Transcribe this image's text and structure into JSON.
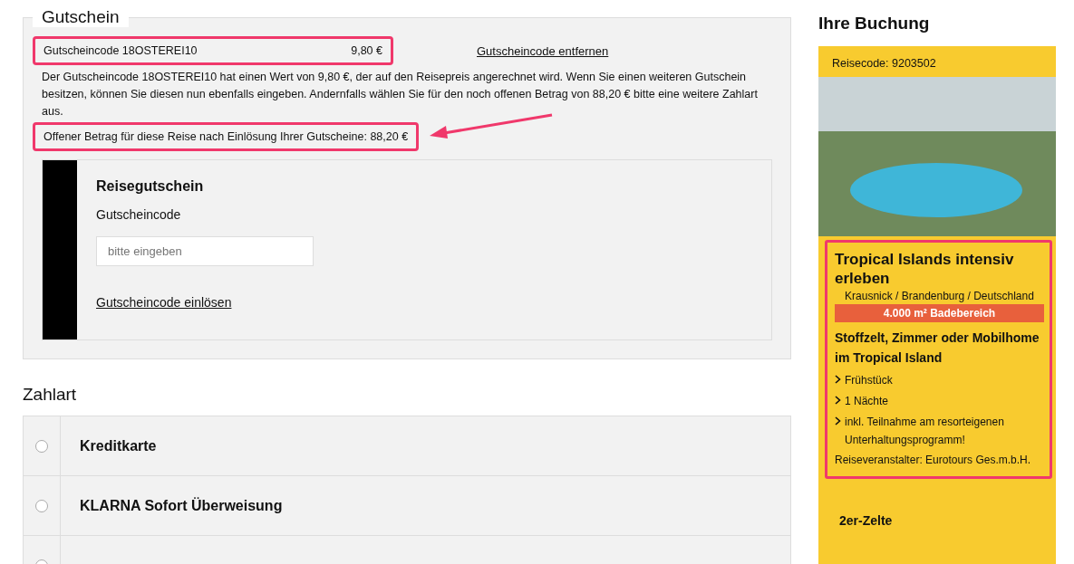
{
  "voucher_section": {
    "title": "Gutschein",
    "applied_code": {
      "label": "Gutscheincode 18OSTEREI10",
      "amount": "9,80 €",
      "highlighted": true
    },
    "remove_link": "Gutscheincode entfernen",
    "info_text": "Der Gutscheincode 18OSTEREI10 hat einen Wert von 9,80 €, der auf den Reisepreis angerechnet wird. Wenn Sie einen weiteren Gutschein besitzen, können Sie diesen nun ebenfalls eingeben. Andernfalls wählen Sie für den noch offenen Betrag von 88,20 € bitte eine weitere Zahlart aus.",
    "open_amount": {
      "text": "Offener Betrag für diese Reise nach Einlösung Ihrer Gutscheine: 88,20 €",
      "highlighted": true
    },
    "travel_voucher": {
      "title": "Reisegutschein",
      "field_label": "Gutscheincode",
      "placeholder": "bitte eingeben",
      "redeem_link": "Gutscheincode einlösen"
    }
  },
  "payment": {
    "title": "Zahlart",
    "options": [
      {
        "label": "Kreditkarte",
        "selected": false
      },
      {
        "label": "KLARNA Sofort Überweisung",
        "selected": false
      },
      {
        "selected": false
      }
    ]
  },
  "booking": {
    "title": "Ihre Buchung",
    "travel_code": "Reisecode: 9203502",
    "offer": {
      "highlighted": true,
      "name": "Tropical Islands intensiv erleben",
      "location": "Krausnick / Brandenburg / Deutschland",
      "badge": "4.000 m² Badebereich",
      "room": "Stoffzelt, Zimmer oder Mobilhome im Tropical Island",
      "features": [
        "Frühstück",
        "1 Nächte",
        "inkl. Teilnahme am resorteigenen Unterhaltungsprogramm!"
      ],
      "operator": "Reiseveranstalter: Eurotours Ges.m.b.H."
    },
    "next_title": "2er-Zelte"
  }
}
